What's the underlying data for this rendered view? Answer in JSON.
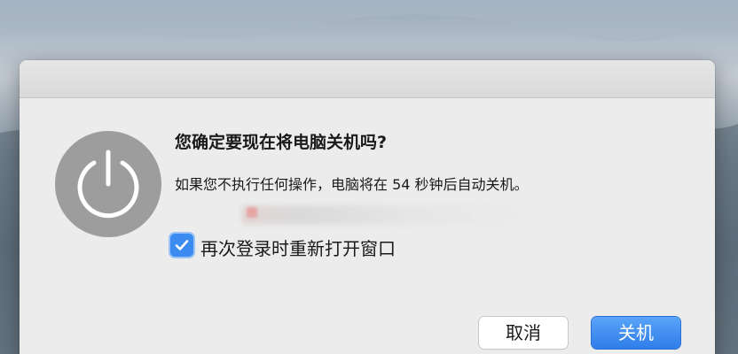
{
  "dialog": {
    "title": "您确定要现在将电脑关机吗?",
    "message": "如果您不执行任何操作，电脑将在 54 秒钟后自动关机。",
    "checkbox": {
      "label": "再次登录时重新打开窗口",
      "checked": true
    },
    "buttons": {
      "cancel_label": "取消",
      "shutdown_label": "关机"
    },
    "icon": "power-icon"
  },
  "colors": {
    "accent": "#3c8bf0",
    "icon_bg": "#9d9d9d",
    "dialog_bg": "#ececec"
  }
}
